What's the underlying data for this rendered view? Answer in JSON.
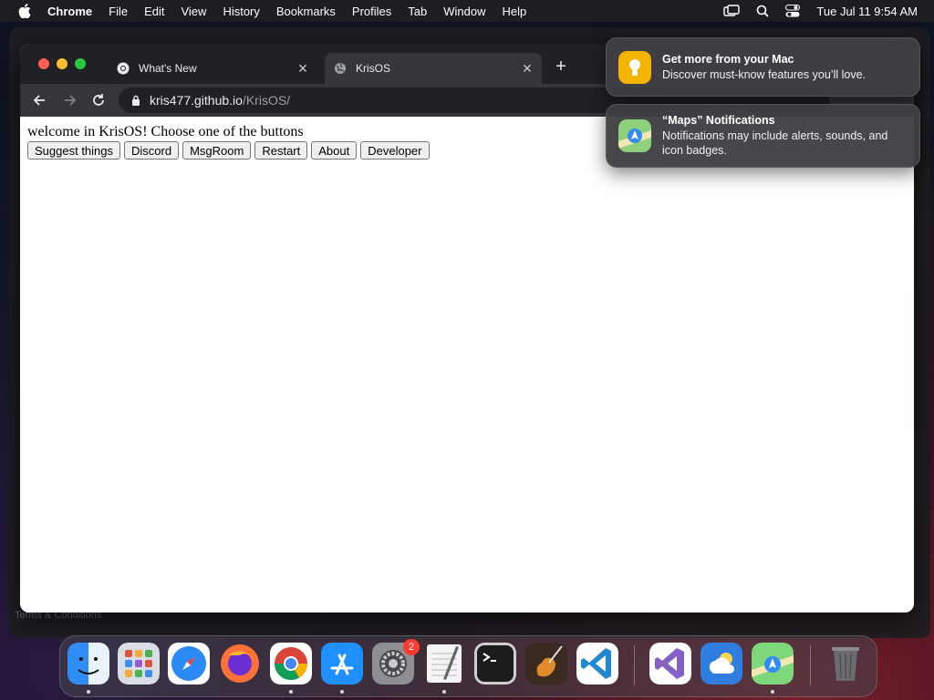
{
  "menubar": {
    "app_name": "Chrome",
    "items": [
      "File",
      "Edit",
      "View",
      "History",
      "Bookmarks",
      "Profiles",
      "Tab",
      "Window",
      "Help"
    ],
    "clock": "Tue Jul 11  9:54 AM"
  },
  "browser": {
    "tabs": [
      {
        "title": "What's New",
        "favicon": "chrome-icon",
        "active": false
      },
      {
        "title": "KrisOS",
        "favicon": "globe-icon",
        "active": true
      }
    ],
    "url_host": "kris477.github.io",
    "url_path": "/KrisOS/"
  },
  "page": {
    "welcome_text": "welcome in KrisOS! Choose one of the buttons",
    "buttons": [
      "Suggest things",
      "Discord",
      "MsgRoom",
      "Restart",
      "About",
      "Developer"
    ]
  },
  "notifications": [
    {
      "title": "Get more from your Mac",
      "body": "Discover must-know features you’ll love.",
      "icon": "tips-icon",
      "color": "#f5b400"
    },
    {
      "title": "“Maps” Notifications",
      "body": "Notifications may include alerts, sounds, and icon badges.",
      "icon": "maps-icon",
      "color": "#4aa3ff"
    }
  ],
  "background": {
    "terms_text": "Terms & Conditions"
  },
  "dock": {
    "apps": [
      {
        "name": "Finder",
        "icon": "finder-icon",
        "color": "#2f8df5",
        "running": true
      },
      {
        "name": "Launchpad",
        "icon": "launchpad-icon",
        "color": "#cfd3db",
        "running": false
      },
      {
        "name": "Safari",
        "icon": "safari-icon",
        "color": "#2a8af6",
        "running": false
      },
      {
        "name": "Firefox",
        "icon": "firefox-icon",
        "color": "#ff7139",
        "running": false
      },
      {
        "name": "Google Chrome",
        "icon": "chrome-icon",
        "color": "#ffffff",
        "running": true
      },
      {
        "name": "App Store",
        "icon": "app-store-icon",
        "color": "#1e90ff",
        "running": true
      },
      {
        "name": "System Settings",
        "icon": "settings-icon",
        "color": "#8e8e93",
        "running": false,
        "badge": "2"
      },
      {
        "name": "TextEdit",
        "icon": "textedit-icon",
        "color": "#f4f4f4",
        "running": true
      },
      {
        "name": "Terminal",
        "icon": "terminal-icon",
        "color": "#1c1c1e",
        "running": false
      },
      {
        "name": "GarageBand",
        "icon": "garageband-icon",
        "color": "#3a2a22",
        "running": false
      },
      {
        "name": "Visual Studio Code",
        "icon": "vscode-icon",
        "color": "#ffffff",
        "running": false
      },
      {
        "name": "Visual Studio",
        "icon": "visual-studio-icon",
        "color": "#ffffff",
        "running": false
      },
      {
        "name": "Weather",
        "icon": "weather-icon",
        "color": "#2f7de1",
        "running": false
      },
      {
        "name": "Maps",
        "icon": "maps-icon",
        "color": "#7dd87a",
        "running": true
      },
      {
        "name": "Trash",
        "icon": "trash-icon",
        "color": "#6b6b70",
        "running": false
      }
    ]
  }
}
